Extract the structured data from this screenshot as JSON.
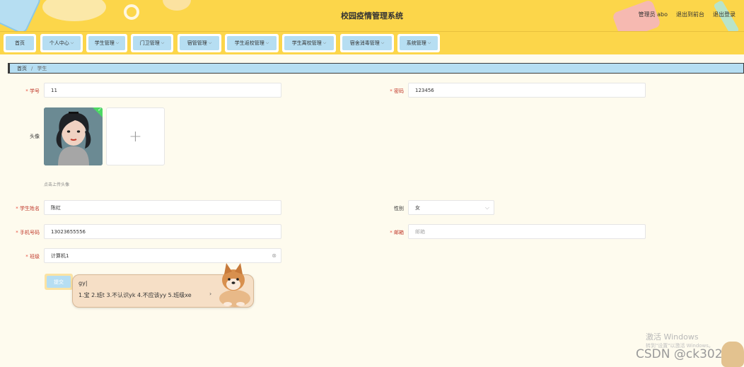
{
  "header": {
    "title": "校园疫情管理系统",
    "user_label": "管理员 abo",
    "to_frontend": "退出到前台",
    "logout": "退出登录"
  },
  "nav": [
    {
      "label": "首页",
      "has_menu": false
    },
    {
      "label": "个人中心",
      "has_menu": true
    },
    {
      "label": "学生管理",
      "has_menu": true
    },
    {
      "label": "门卫管理",
      "has_menu": true
    },
    {
      "label": "宿管管理",
      "has_menu": true
    },
    {
      "label": "学生返校管理",
      "has_menu": true
    },
    {
      "label": "学生离校管理",
      "has_menu": true
    },
    {
      "label": "宿舍消毒管理",
      "has_menu": true
    },
    {
      "label": "系统管理",
      "has_menu": true
    }
  ],
  "breadcrumb": {
    "home": "首页",
    "separator": "/",
    "current": "学生"
  },
  "form": {
    "student_id": {
      "label": "学号",
      "value": "11"
    },
    "password": {
      "label": "密码",
      "value": "123456"
    },
    "avatar": {
      "label": "头像",
      "hint": "点击上传头像",
      "plus": "+"
    },
    "name": {
      "label": "学生姓名",
      "value": "陈红"
    },
    "gender": {
      "label": "性别",
      "value": "女"
    },
    "phone": {
      "label": "手机号码",
      "value": "13023655556"
    },
    "email": {
      "label": "邮箱",
      "placeholder": "邮箱"
    },
    "class": {
      "label": "班级",
      "value": "计算机1"
    },
    "submit": "提交"
  },
  "ime": {
    "code": "gy|",
    "candidates": "1.宝  2.班t  3.不认识yk  4.不应该yy  5.班级xe",
    "arrow": "›"
  },
  "watermark": {
    "activate": "激活 Windows",
    "activate_sub": "转到\"设置\"以激活 Windows。",
    "csdn": "CSDN @ck3027"
  }
}
